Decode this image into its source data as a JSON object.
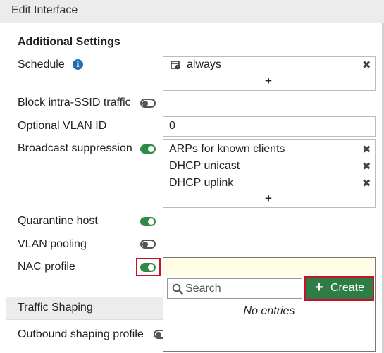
{
  "window": {
    "title": "Edit Interface"
  },
  "additional_settings": {
    "heading": "Additional Settings",
    "schedule": {
      "label": "Schedule",
      "info_icon": "i",
      "entries": [
        "always"
      ],
      "add_symbol": "+"
    },
    "block_intra_ssid": {
      "label": "Block intra-SSID traffic",
      "enabled": false
    },
    "optional_vlan_id": {
      "label": "Optional VLAN ID",
      "value": "0"
    },
    "broadcast_suppression": {
      "label": "Broadcast suppression",
      "enabled": true,
      "entries": [
        "ARPs for known clients",
        "DHCP unicast",
        "DHCP uplink"
      ],
      "add_symbol": "+"
    },
    "quarantine_host": {
      "label": "Quarantine host",
      "enabled": true
    },
    "vlan_pooling": {
      "label": "VLAN pooling",
      "enabled": false
    },
    "nac_profile": {
      "label": "NAC profile",
      "enabled": true
    }
  },
  "traffic_shaping": {
    "heading": "Traffic Shaping",
    "outbound_shaping_profile": {
      "label": "Outbound shaping profile"
    }
  },
  "nac_dropdown": {
    "search_placeholder": "Search",
    "create_label": "Create",
    "create_symbol": "+",
    "empty_text": "No entries"
  },
  "colors": {
    "toggle_on": "#2e8b46",
    "create_button": "#2e7d45",
    "highlight": "#c8102e",
    "info_icon": "#1f6fb2"
  },
  "icons": [
    "info-icon",
    "schedule-icon",
    "remove-icon",
    "plus-icon",
    "search-icon"
  ]
}
